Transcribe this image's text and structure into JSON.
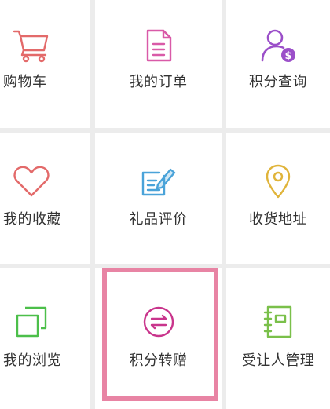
{
  "menu": {
    "items": [
      {
        "label": "购物车",
        "icon": "shopping-cart-icon",
        "color": "#e36a6a"
      },
      {
        "label": "我的订单",
        "icon": "document-icon",
        "color": "#d95aa8"
      },
      {
        "label": "积分查询",
        "icon": "user-points-icon",
        "color": "#9b4fc9"
      },
      {
        "label": "我的收藏",
        "icon": "heart-icon",
        "color": "#e36a6a"
      },
      {
        "label": "礼品评价",
        "icon": "edit-icon",
        "color": "#4aa3d9"
      },
      {
        "label": "收货地址",
        "icon": "location-pin-icon",
        "color": "#e0b43a"
      },
      {
        "label": "我的浏览",
        "icon": "layers-icon",
        "color": "#4cbf4a"
      },
      {
        "label": "积分转赠",
        "icon": "transfer-icon",
        "color": "#c9358c"
      },
      {
        "label": "受让人管理",
        "icon": "notebook-icon",
        "color": "#7ac04a"
      }
    ]
  },
  "highlight_color": "#e884a4"
}
